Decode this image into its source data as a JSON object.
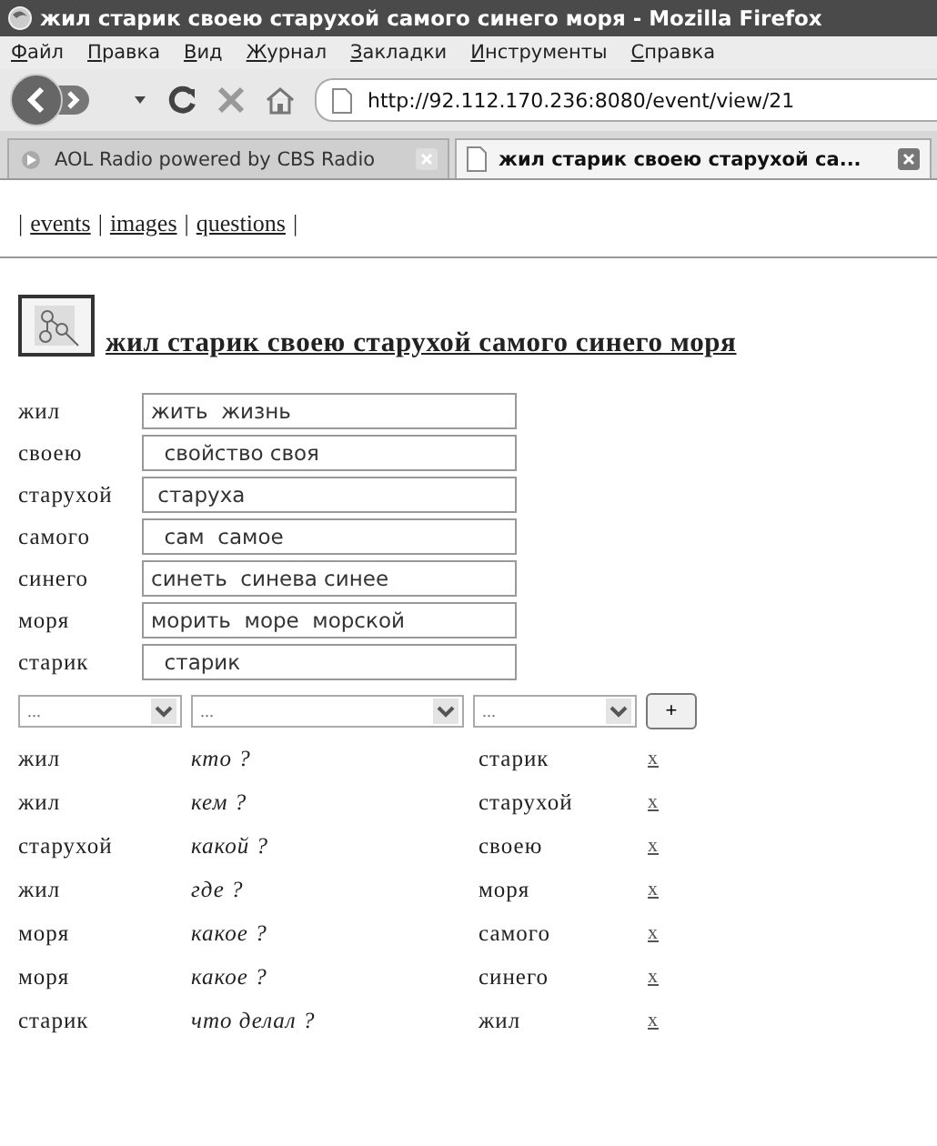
{
  "window": {
    "title": "жил старик своею старухой самого синего моря - Mozilla Firefox"
  },
  "menu": [
    "Файл",
    "Правка",
    "Вид",
    "Журнал",
    "Закладки",
    "Инструменты",
    "Справка"
  ],
  "address": {
    "value": "http://92.112.170.236:8080/event/view/21"
  },
  "tabs": [
    {
      "label": "AOL Radio powered by CBS Radio",
      "selected": false
    },
    {
      "label": "жил старик своею старухой са...",
      "selected": true
    }
  ],
  "nav_links": [
    {
      "kind": "separator",
      "text": "|"
    },
    {
      "kind": "link",
      "text": "events"
    },
    {
      "kind": "separator",
      "text": "|"
    },
    {
      "kind": "link",
      "text": "images"
    },
    {
      "kind": "separator",
      "text": "|"
    },
    {
      "kind": "link",
      "text": "questions"
    },
    {
      "kind": "separator",
      "text": "|"
    }
  ],
  "heading": "жил старик своею старухой самого синего моря",
  "words": [
    {
      "word": "жил",
      "value": "жить  жизнь"
    },
    {
      "word": "своею",
      "value": "  свойство своя"
    },
    {
      "word": "старухой",
      "value": " старуха"
    },
    {
      "word": "самого",
      "value": "  сам  самое"
    },
    {
      "word": "синего",
      "value": "синеть  синева синее"
    },
    {
      "word": "моря",
      "value": "морить  море  морской"
    },
    {
      "word": "старик",
      "value": "  старик"
    }
  ],
  "selects": [
    "...",
    "...",
    "..."
  ],
  "add_button": "+",
  "relations": [
    {
      "from": "жил",
      "question": "кто ?",
      "to": "старик",
      "remove": "x"
    },
    {
      "from": "жил",
      "question": "кем ?",
      "to": "старухой",
      "remove": "x"
    },
    {
      "from": "старухой",
      "question": "какой ?",
      "to": "своею",
      "remove": "x"
    },
    {
      "from": "жил",
      "question": "где ?",
      "to": "моря",
      "remove": "x"
    },
    {
      "from": "моря",
      "question": "какое ?",
      "to": "самого",
      "remove": "x"
    },
    {
      "from": "моря",
      "question": "какое ?",
      "to": "синего",
      "remove": "x"
    },
    {
      "from": "старик",
      "question": "что делал ?",
      "to": "жил",
      "remove": "x"
    }
  ]
}
